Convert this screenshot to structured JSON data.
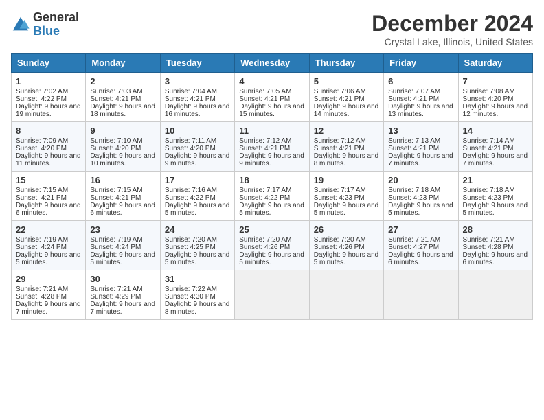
{
  "header": {
    "logo_general": "General",
    "logo_blue": "Blue",
    "title": "December 2024",
    "location": "Crystal Lake, Illinois, United States"
  },
  "days_of_week": [
    "Sunday",
    "Monday",
    "Tuesday",
    "Wednesday",
    "Thursday",
    "Friday",
    "Saturday"
  ],
  "weeks": [
    [
      {
        "num": "1",
        "sunrise": "7:02 AM",
        "sunset": "4:22 PM",
        "daylight": "9 hours and 19 minutes."
      },
      {
        "num": "2",
        "sunrise": "7:03 AM",
        "sunset": "4:21 PM",
        "daylight": "9 hours and 18 minutes."
      },
      {
        "num": "3",
        "sunrise": "7:04 AM",
        "sunset": "4:21 PM",
        "daylight": "9 hours and 16 minutes."
      },
      {
        "num": "4",
        "sunrise": "7:05 AM",
        "sunset": "4:21 PM",
        "daylight": "9 hours and 15 minutes."
      },
      {
        "num": "5",
        "sunrise": "7:06 AM",
        "sunset": "4:21 PM",
        "daylight": "9 hours and 14 minutes."
      },
      {
        "num": "6",
        "sunrise": "7:07 AM",
        "sunset": "4:21 PM",
        "daylight": "9 hours and 13 minutes."
      },
      {
        "num": "7",
        "sunrise": "7:08 AM",
        "sunset": "4:20 PM",
        "daylight": "9 hours and 12 minutes."
      }
    ],
    [
      {
        "num": "8",
        "sunrise": "7:09 AM",
        "sunset": "4:20 PM",
        "daylight": "9 hours and 11 minutes."
      },
      {
        "num": "9",
        "sunrise": "7:10 AM",
        "sunset": "4:20 PM",
        "daylight": "9 hours and 10 minutes."
      },
      {
        "num": "10",
        "sunrise": "7:11 AM",
        "sunset": "4:20 PM",
        "daylight": "9 hours and 9 minutes."
      },
      {
        "num": "11",
        "sunrise": "7:12 AM",
        "sunset": "4:21 PM",
        "daylight": "9 hours and 9 minutes."
      },
      {
        "num": "12",
        "sunrise": "7:12 AM",
        "sunset": "4:21 PM",
        "daylight": "9 hours and 8 minutes."
      },
      {
        "num": "13",
        "sunrise": "7:13 AM",
        "sunset": "4:21 PM",
        "daylight": "9 hours and 7 minutes."
      },
      {
        "num": "14",
        "sunrise": "7:14 AM",
        "sunset": "4:21 PM",
        "daylight": "9 hours and 7 minutes."
      }
    ],
    [
      {
        "num": "15",
        "sunrise": "7:15 AM",
        "sunset": "4:21 PM",
        "daylight": "9 hours and 6 minutes."
      },
      {
        "num": "16",
        "sunrise": "7:15 AM",
        "sunset": "4:21 PM",
        "daylight": "9 hours and 6 minutes."
      },
      {
        "num": "17",
        "sunrise": "7:16 AM",
        "sunset": "4:22 PM",
        "daylight": "9 hours and 5 minutes."
      },
      {
        "num": "18",
        "sunrise": "7:17 AM",
        "sunset": "4:22 PM",
        "daylight": "9 hours and 5 minutes."
      },
      {
        "num": "19",
        "sunrise": "7:17 AM",
        "sunset": "4:23 PM",
        "daylight": "9 hours and 5 minutes."
      },
      {
        "num": "20",
        "sunrise": "7:18 AM",
        "sunset": "4:23 PM",
        "daylight": "9 hours and 5 minutes."
      },
      {
        "num": "21",
        "sunrise": "7:18 AM",
        "sunset": "4:23 PM",
        "daylight": "9 hours and 5 minutes."
      }
    ],
    [
      {
        "num": "22",
        "sunrise": "7:19 AM",
        "sunset": "4:24 PM",
        "daylight": "9 hours and 5 minutes."
      },
      {
        "num": "23",
        "sunrise": "7:19 AM",
        "sunset": "4:24 PM",
        "daylight": "9 hours and 5 minutes."
      },
      {
        "num": "24",
        "sunrise": "7:20 AM",
        "sunset": "4:25 PM",
        "daylight": "9 hours and 5 minutes."
      },
      {
        "num": "25",
        "sunrise": "7:20 AM",
        "sunset": "4:26 PM",
        "daylight": "9 hours and 5 minutes."
      },
      {
        "num": "26",
        "sunrise": "7:20 AM",
        "sunset": "4:26 PM",
        "daylight": "9 hours and 5 minutes."
      },
      {
        "num": "27",
        "sunrise": "7:21 AM",
        "sunset": "4:27 PM",
        "daylight": "9 hours and 6 minutes."
      },
      {
        "num": "28",
        "sunrise": "7:21 AM",
        "sunset": "4:28 PM",
        "daylight": "9 hours and 6 minutes."
      }
    ],
    [
      {
        "num": "29",
        "sunrise": "7:21 AM",
        "sunset": "4:28 PM",
        "daylight": "9 hours and 7 minutes."
      },
      {
        "num": "30",
        "sunrise": "7:21 AM",
        "sunset": "4:29 PM",
        "daylight": "9 hours and 7 minutes."
      },
      {
        "num": "31",
        "sunrise": "7:22 AM",
        "sunset": "4:30 PM",
        "daylight": "9 hours and 8 minutes."
      },
      null,
      null,
      null,
      null
    ]
  ]
}
